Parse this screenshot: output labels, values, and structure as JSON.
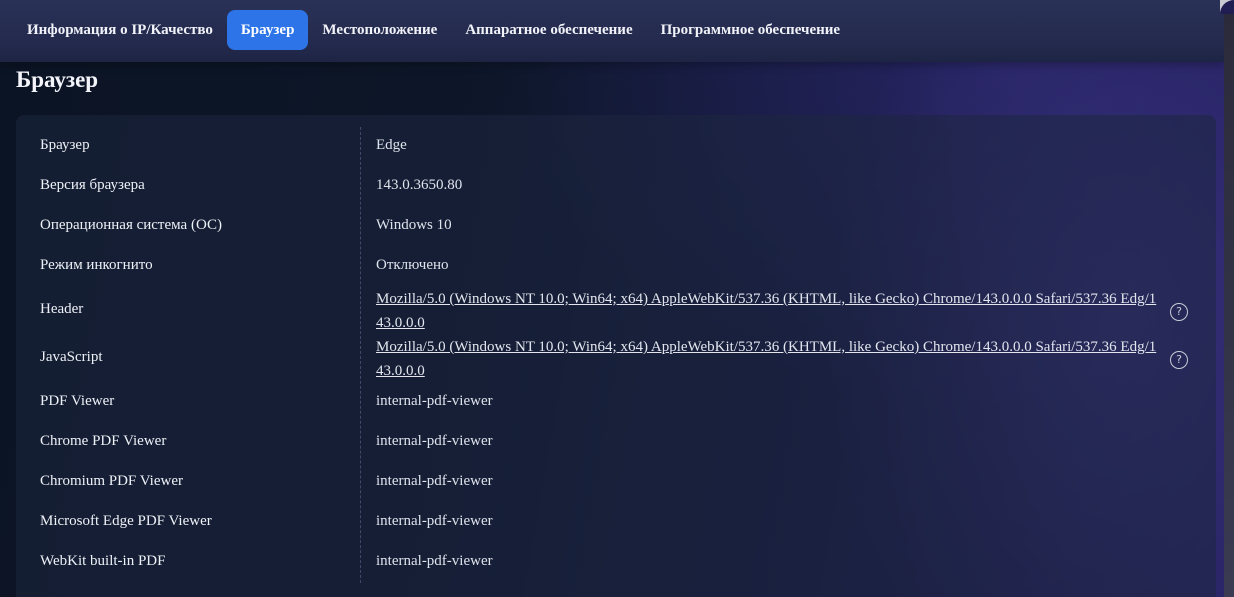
{
  "nav": {
    "tabs": [
      {
        "label": "Информация о IP/Качество",
        "active": false
      },
      {
        "label": "Браузер",
        "active": true
      },
      {
        "label": "Местоположение",
        "active": false
      },
      {
        "label": "Аппаратное обеспечение",
        "active": false
      },
      {
        "label": "Программное обеспечение",
        "active": false
      }
    ]
  },
  "section": {
    "title": "Браузер"
  },
  "rows": [
    {
      "label": "Браузер",
      "value": "Edge"
    },
    {
      "label": "Версия браузера",
      "value": "143.0.3650.80"
    },
    {
      "label": "Операционная система (ОС)",
      "value": "Windows 10"
    },
    {
      "label": "Режим инкогнито",
      "value": "Отключено"
    },
    {
      "label": "Header",
      "value": "Mozilla/5.0 (Windows NT 10.0; Win64; x64) AppleWebKit/537.36 (KHTML, like Gecko) Chrome/143.0.0.0 Safari/537.36 Edg/143.0.0.0"
    },
    {
      "label": "JavaScript",
      "value": "Mozilla/5.0 (Windows NT 10.0; Win64; x64) AppleWebKit/537.36 (KHTML, like Gecko) Chrome/143.0.0.0 Safari/537.36 Edg/143.0.0.0"
    },
    {
      "label": "PDF Viewer",
      "value": "internal-pdf-viewer"
    },
    {
      "label": "Chrome PDF Viewer",
      "value": "internal-pdf-viewer"
    },
    {
      "label": "Chromium PDF Viewer",
      "value": "internal-pdf-viewer"
    },
    {
      "label": "Microsoft Edge PDF Viewer",
      "value": "internal-pdf-viewer"
    },
    {
      "label": "WebKit built-in PDF",
      "value": "internal-pdf-viewer"
    }
  ],
  "icons": {
    "help": "question-circle-icon"
  },
  "colors": {
    "accent": "#2d74e8"
  }
}
